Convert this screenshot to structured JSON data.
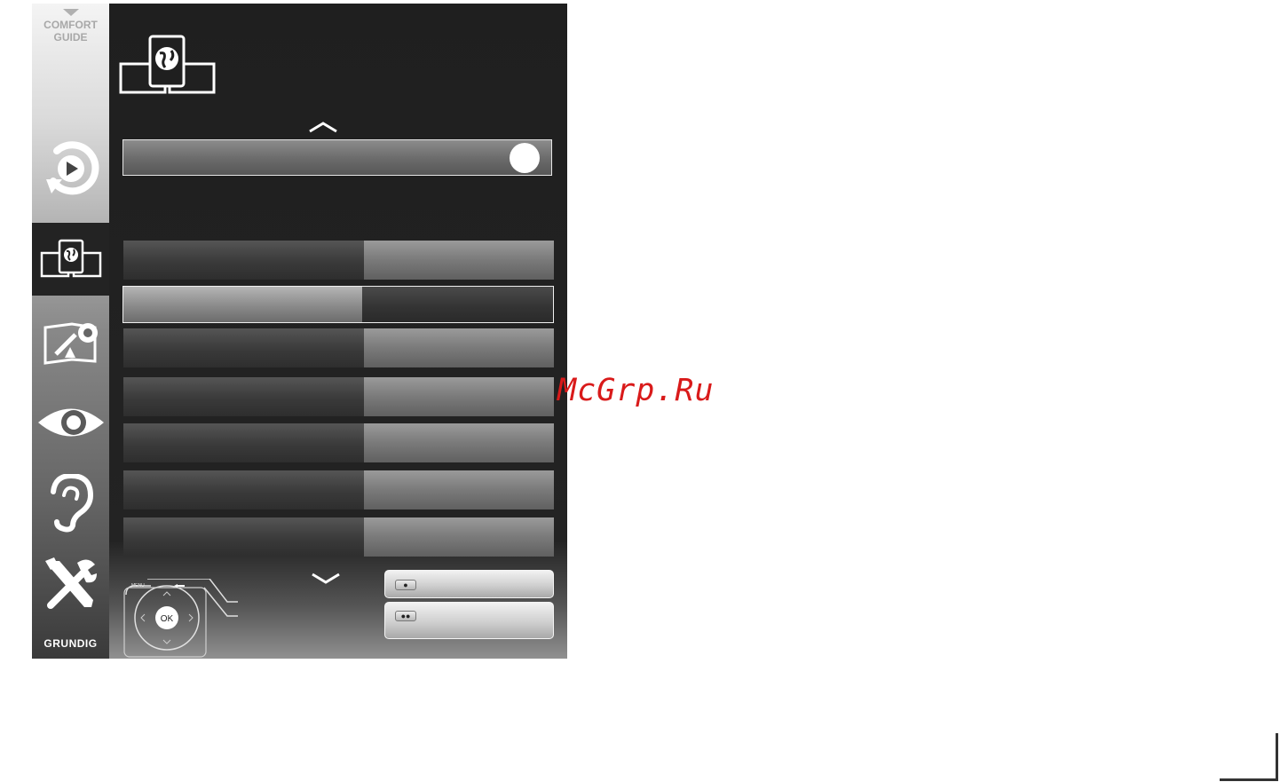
{
  "sidebar": {
    "comfort_guide": {
      "line1": "COMFORT",
      "line2": "GUIDE"
    },
    "items": [
      {
        "name": "source",
        "icon": "source-playback-icon",
        "selected": false
      },
      {
        "name": "network",
        "icon": "network-globe-icon",
        "selected": true
      },
      {
        "name": "installation",
        "icon": "antenna-install-icon",
        "selected": false
      },
      {
        "name": "picture",
        "icon": "eye-icon",
        "selected": false
      },
      {
        "name": "sound",
        "icon": "ear-icon",
        "selected": false
      },
      {
        "name": "setup",
        "icon": "tools-icon",
        "selected": false
      }
    ],
    "brand": "GRUNDIG"
  },
  "panel": {
    "header_icon": "network-globe-icon",
    "slider": {
      "level": 1.0
    },
    "rows_count_visible": 7,
    "selected_row": 2
  },
  "remote": {
    "ok_label": "OK",
    "menu_label": "MENU"
  },
  "buttons": {
    "btn1_key": "●",
    "btn2_key": "●●"
  },
  "watermark": "McGrp.Ru",
  "colors": {
    "panel_bg": "#232323",
    "highlight_border": "#f0f0f0",
    "watermark": "#d91a1a"
  }
}
